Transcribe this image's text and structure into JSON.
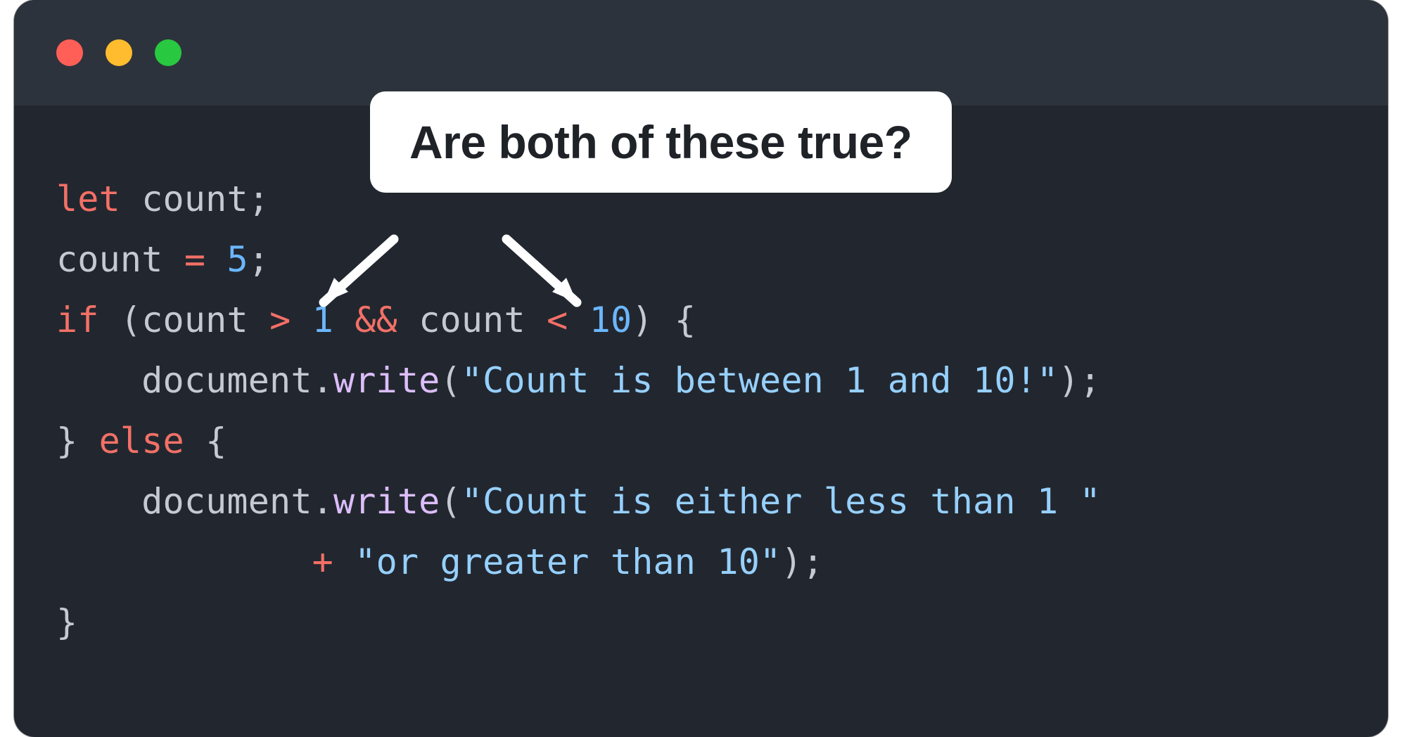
{
  "callout": {
    "text": "Are both of these true?"
  },
  "code": {
    "l1": {
      "let": "let",
      "sp1": " ",
      "count": "count",
      "semi": ";"
    },
    "l2": {
      "count": "count",
      "sp1": " ",
      "eq": "=",
      "sp2": " ",
      "five": "5",
      "semi": ";"
    },
    "l3": {
      "if": "if",
      "sp1": " ",
      "lp": "(",
      "count1": "count",
      "sp2": " ",
      "gt": ">",
      "sp3": " ",
      "one": "1",
      "sp4": " ",
      "and": "&&",
      "sp5": " ",
      "count2": "count",
      "sp6": " ",
      "lt": "<",
      "sp7": " ",
      "ten": "10",
      "rp": ")",
      "sp8": " ",
      "lb": "{"
    },
    "l4": {
      "indent": "    ",
      "doc": "document",
      "dot": ".",
      "write": "write",
      "lp": "(",
      "str": "\"Count is between 1 and 10!\"",
      "rp": ")",
      "semi": ";"
    },
    "l5": {
      "rb": "}",
      "sp1": " ",
      "else": "else",
      "sp2": " ",
      "lb": "{"
    },
    "l6": {
      "indent": "    ",
      "doc": "document",
      "dot": ".",
      "write": "write",
      "lp": "(",
      "str": "\"Count is either less than 1 \""
    },
    "l7": {
      "indent": "            ",
      "plus": "+",
      "sp": " ",
      "str": "\"or greater than 10\"",
      "rp": ")",
      "semi": ";"
    },
    "l8": {
      "rb": "}"
    }
  },
  "colors": {
    "background": "#22272f",
    "titlebar": "#2d333c",
    "keyword": "#f47067",
    "operator": "#f47067",
    "number": "#6cb6ff",
    "function": "#dcbdfb",
    "string": "#96d0ff",
    "default": "#c4c9d2",
    "trafficRed": "#ff5f57",
    "trafficYellow": "#febc2e",
    "trafficGreen": "#28c840"
  }
}
